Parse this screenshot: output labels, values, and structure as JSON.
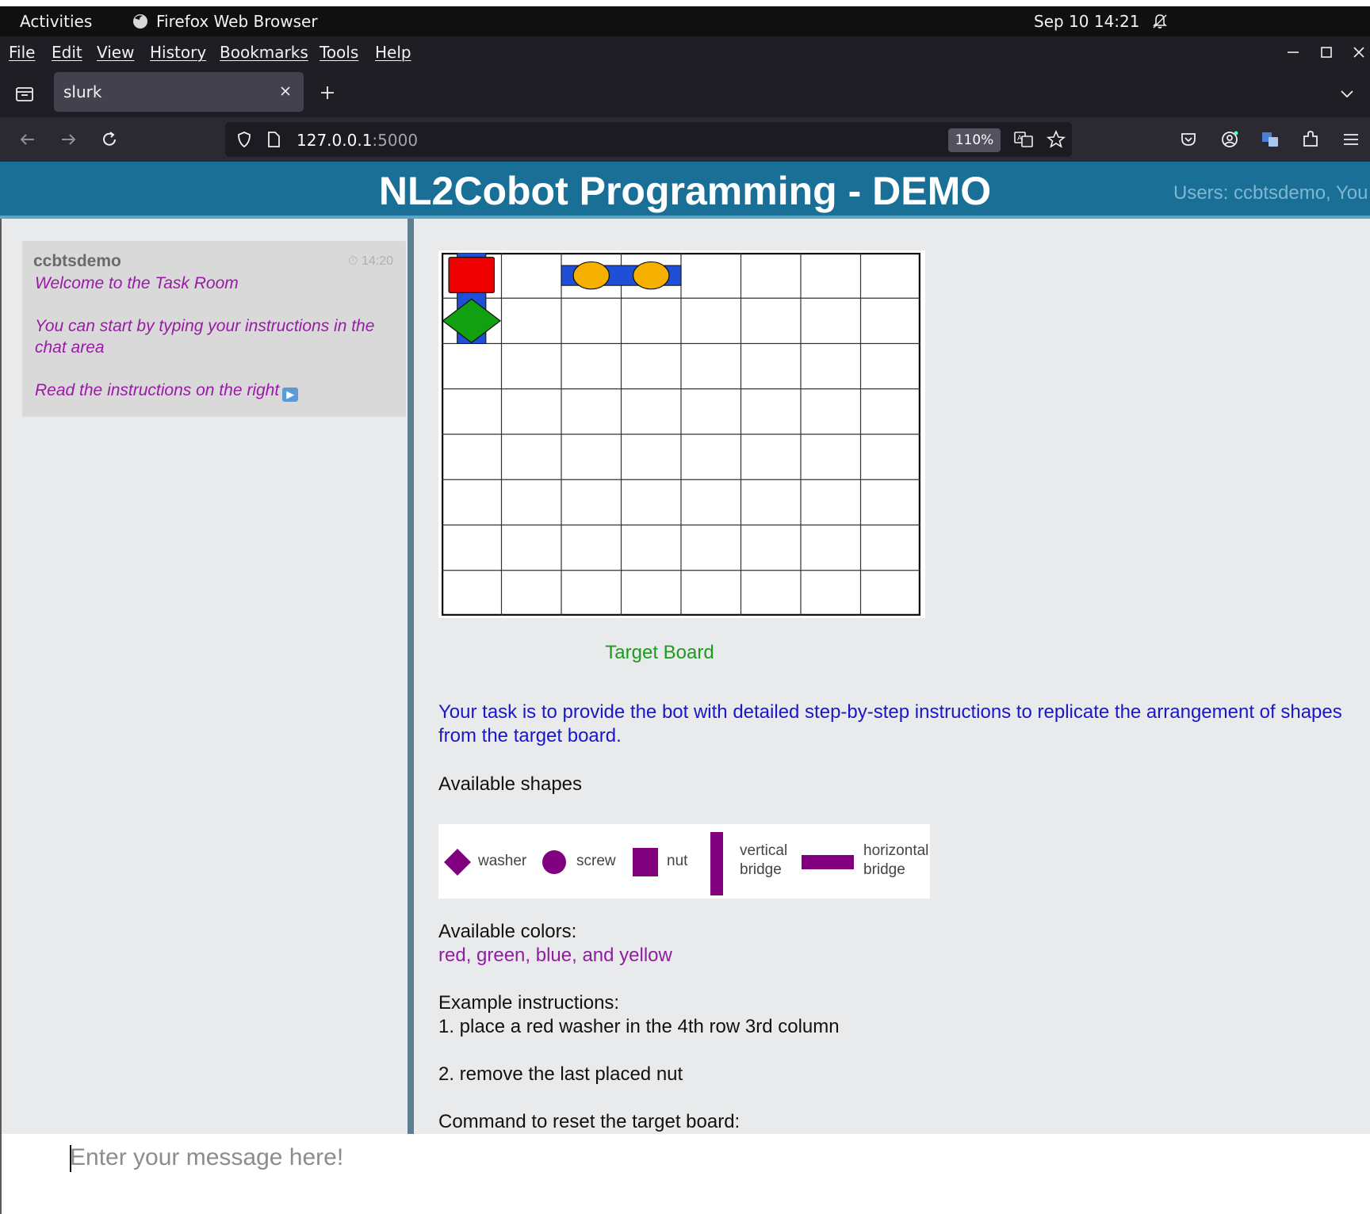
{
  "system": {
    "activities": "Activities",
    "app_name": "Firefox Web Browser",
    "clock": "Sep 10  14:21"
  },
  "menu": [
    "File",
    "Edit",
    "View",
    "History",
    "Bookmarks",
    "Tools",
    "Help"
  ],
  "tab": {
    "title": "slurk"
  },
  "address": {
    "host": "127.0.0.1",
    "port": ":5000",
    "zoom": "110%"
  },
  "page": {
    "title": "NL2Cobot Programming - DEMO",
    "users": "Users: ccbtsdemo, You"
  },
  "chat": {
    "message": {
      "user": "ccbtsdemo",
      "time": "⏱ 14:20",
      "lines": [
        "Welcome to the Task Room",
        "You can start by typing your instructions in the chat area",
        "Read the instructions on the right"
      ]
    },
    "input_placeholder": "Enter your message here!"
  },
  "board": {
    "caption": "Target Board",
    "rows": 8,
    "cols": 8,
    "colors": {
      "red": "#ee0000",
      "green": "#10a010",
      "blue": "#1f4fd6",
      "yellow": "#f5b000"
    },
    "pieces": [
      {
        "shape": "vertical bridge",
        "color": "blue",
        "row": 1,
        "col": 1,
        "span": 2
      },
      {
        "shape": "nut",
        "color": "red",
        "row": 1,
        "col": 1
      },
      {
        "shape": "washer",
        "color": "green",
        "row": 2,
        "col": 1
      },
      {
        "shape": "horizontal bridge",
        "color": "blue",
        "row": 1,
        "col": 3,
        "span": 2
      },
      {
        "shape": "screw",
        "color": "yellow",
        "row": 1,
        "col": 3
      },
      {
        "shape": "screw",
        "color": "yellow",
        "row": 1,
        "col": 4
      }
    ]
  },
  "instructions": {
    "task": "Your task is to provide the bot with detailed step-by-step instructions to replicate the arrangement of shapes from the target board.",
    "shapes_title": "Available shapes",
    "shapes": [
      "washer",
      "screw",
      "nut",
      "vertical bridge",
      "horizontal bridge"
    ],
    "shape_color": "#800080",
    "colors_title": "Available colors:",
    "colors": "red, green, blue, and yellow",
    "example_title": "Example instructions:",
    "example_1": "1. place a red washer in the 4th row 3rd column",
    "example_2": "2. remove the last placed nut",
    "reset_title": "Command to reset the target board:"
  }
}
